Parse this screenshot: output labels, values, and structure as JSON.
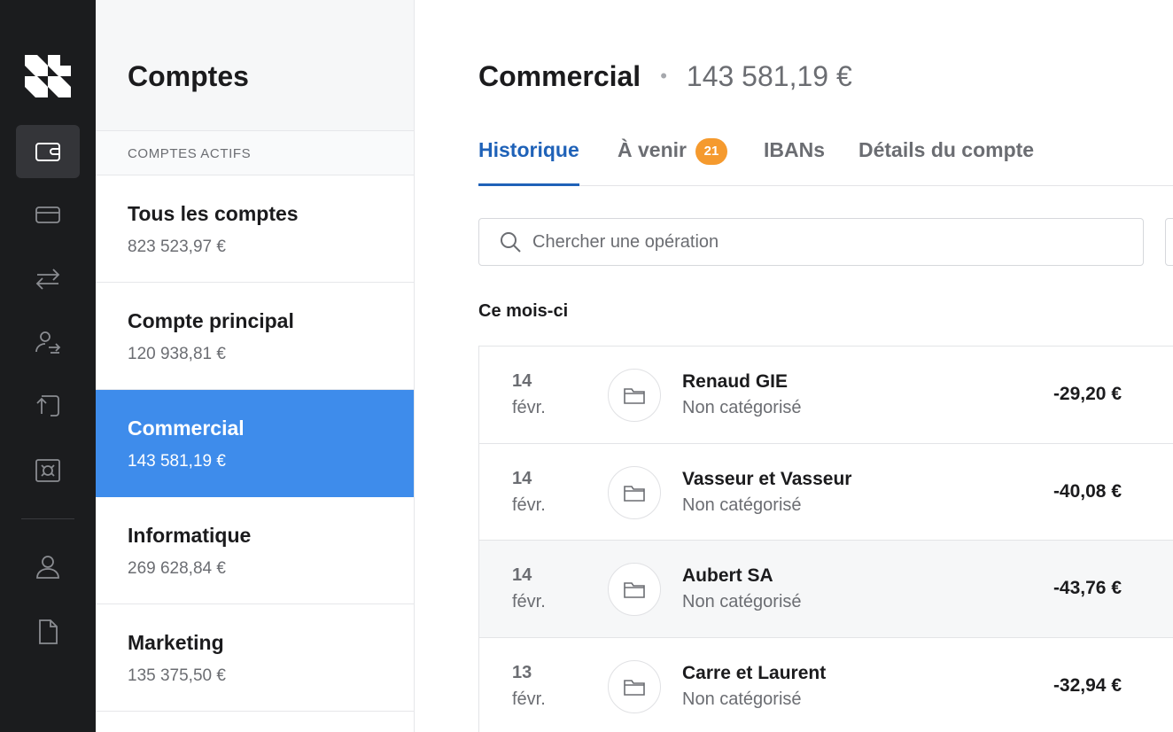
{
  "rail": {
    "items": [
      {
        "name": "accounts-wallet-icon",
        "active": true
      },
      {
        "name": "card-icon",
        "active": false
      },
      {
        "name": "transfers-icon",
        "active": false
      },
      {
        "name": "beneficiaries-icon",
        "active": false
      },
      {
        "name": "operations-icon",
        "active": false
      },
      {
        "name": "safe-icon",
        "active": false
      },
      {
        "name": "user-icon",
        "active": false
      },
      {
        "name": "document-icon",
        "active": false
      }
    ]
  },
  "accounts": {
    "title": "Comptes",
    "section_label": "COMPTES ACTIFS",
    "items": [
      {
        "name": "Tous les comptes",
        "balance": "823 523,97 €"
      },
      {
        "name": "Compte principal",
        "balance": "120 938,81 €"
      },
      {
        "name": "Commercial",
        "balance": "143 581,19 €"
      },
      {
        "name": "Informatique",
        "balance": "269 628,84 €"
      },
      {
        "name": "Marketing",
        "balance": "135 375,50 €"
      }
    ],
    "selected": "Commercial"
  },
  "main": {
    "title": "Commercial",
    "separator": "•",
    "balance": "143 581,19 €",
    "tabs": [
      {
        "label": "Historique",
        "active": true
      },
      {
        "label": "À venir",
        "badge": "21"
      },
      {
        "label": "IBANs"
      },
      {
        "label": "Détails du compte"
      }
    ],
    "search": {
      "placeholder": "Chercher une opération",
      "value": ""
    },
    "period_label": "Ce mois-ci",
    "transactions": [
      {
        "day": "14",
        "month": "févr.",
        "payee": "Renaud GIE",
        "category": "Non catégorisé",
        "amount": "-29,20 €"
      },
      {
        "day": "14",
        "month": "févr.",
        "payee": "Vasseur et Vasseur",
        "category": "Non catégorisé",
        "amount": "-40,08 €"
      },
      {
        "day": "14",
        "month": "févr.",
        "payee": "Aubert SA",
        "category": "Non catégorisé",
        "amount": "-43,76 €"
      },
      {
        "day": "13",
        "month": "févr.",
        "payee": "Carre et Laurent",
        "category": "Non catégorisé",
        "amount": "-32,94 €"
      }
    ]
  },
  "colors": {
    "rail_bg": "#1b1c1e",
    "accent_blue": "#1f62b8",
    "selected_account": "#3e8ceb",
    "badge": "#f59a2e"
  }
}
